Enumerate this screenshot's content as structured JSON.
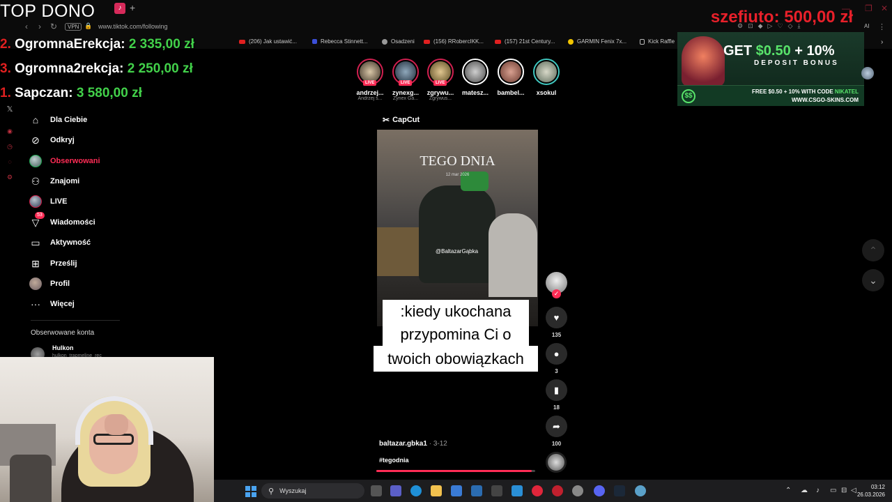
{
  "browser": {
    "url": "www.tiktok.com/following",
    "vpn_label": "VPN",
    "ai_label": "AI",
    "bookmarks": [
      {
        "label": "(206) Jak ustawić...",
        "icon": "youtube"
      },
      {
        "label": "Rebecca Stinnett...",
        "icon": "bookmark"
      },
      {
        "label": "Osadzeni",
        "icon": "grey"
      },
      {
        "label": "(156) RRobercIKK...",
        "icon": "youtube"
      },
      {
        "label": "(157) 21st Century...",
        "icon": "youtube"
      },
      {
        "label": "GARMIN Fenix 7x...",
        "icon": "garmin"
      },
      {
        "label": "Kick Raffle",
        "icon": "doc"
      }
    ]
  },
  "overlay": {
    "top_dono_title": "TOP DONO",
    "top_donors": [
      {
        "rank": "2.",
        "name": "OgromnaErekcja:",
        "amount": "2 335,00 zł"
      },
      {
        "rank": "3.",
        "name": "Ogromna2rekcja:",
        "amount": "2 250,00 zł"
      },
      {
        "rank": "1.",
        "name": "Sapczan:",
        "amount": "3 580,00 zł"
      }
    ],
    "latest_donation": "szefiuto: 500,00 zł"
  },
  "sidebar": {
    "items": [
      {
        "label": "Dla Ciebie",
        "icon": "home-icon"
      },
      {
        "label": "Odkryj",
        "icon": "compass-icon"
      },
      {
        "label": "Obserwowani",
        "icon": "following-avatar-icon",
        "active": true
      },
      {
        "label": "Znajomi",
        "icon": "friends-icon"
      },
      {
        "label": "LIVE",
        "icon": "live-avatar-icon"
      },
      {
        "label": "Wiadomości",
        "icon": "messages-icon",
        "badge": "53"
      },
      {
        "label": "Aktywność",
        "icon": "activity-icon"
      },
      {
        "label": "Prześlij",
        "icon": "upload-icon"
      },
      {
        "label": "Profil",
        "icon": "profile-avatar-icon"
      },
      {
        "label": "Więcej",
        "icon": "more-icon"
      }
    ],
    "followed_heading": "Obserwowane konta",
    "followed_accounts": [
      {
        "name": "Hulkon",
        "sub": "hulkon_trapmeline_rec"
      }
    ]
  },
  "stories": [
    {
      "name": "andrzej...",
      "sub": "Andrzej s...",
      "live": true
    },
    {
      "name": "zynexg...",
      "sub": "Zynex Ga...",
      "live": true
    },
    {
      "name": "zgrywu...",
      "sub": "Zgrywus...",
      "live": true
    },
    {
      "name": "matesz...",
      "sub": "",
      "live": false
    },
    {
      "name": "bambel...",
      "sub": "",
      "live": false
    },
    {
      "name": "xsokul",
      "sub": "",
      "live": false
    }
  ],
  "live_label": "LIVE",
  "video": {
    "editor_label": "CapCut",
    "overlay_title": "TEGO DNIA",
    "overlay_date": "12 mar 2026",
    "watermark": "@BaltazarGąbka",
    "caption_lines": [
      ":kiedy ukochana",
      "przypomina Ci o",
      "twoich obowiązkach"
    ],
    "author": "baltazar.gbka1",
    "date": "3-12",
    "hashtag": "#tegodnia",
    "progress": 0.98
  },
  "actions": {
    "likes": "135",
    "comments": "3",
    "saves": "18",
    "shares": "100"
  },
  "ad": {
    "headline_white": "GET ",
    "headline_green": "$0.50",
    "headline_tail": " + 10%",
    "subline": "DEPOSIT BONUS",
    "code_text": "FREE $0.50 + 10% WITH CODE ",
    "code": "NIKATEL",
    "site": "WWW.CSGO-SKINS.COM",
    "coin": "$$"
  },
  "taskbar": {
    "search_label": "Wyszukaj",
    "time": "03:12",
    "date": "26.03.2026"
  },
  "colors": {
    "accent": "#fe2c55",
    "donor_rank": "#e02020",
    "donor_amount": "#42d14a",
    "ad_green": "#58e36a"
  }
}
